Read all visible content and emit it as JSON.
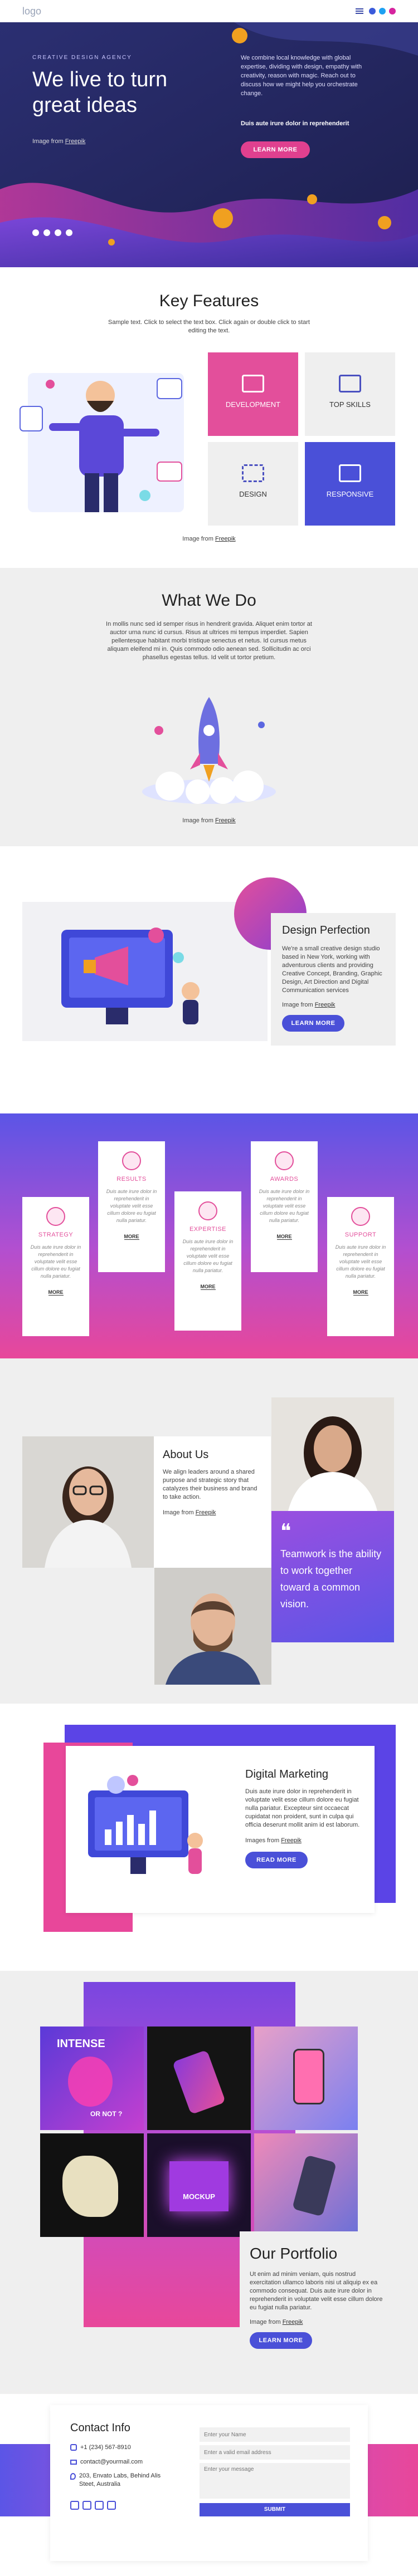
{
  "header": {
    "logo": "logo",
    "colors": {
      "menu": "#3b4aa8",
      "facebook": "#3b5bdb",
      "twitter": "#1da1f2",
      "instagram": "#d6249f"
    }
  },
  "hero": {
    "eyebrow": "CREATIVE DESIGN AGENCY",
    "title_line1": "We live to turn",
    "title_line2": "great ideas",
    "body": "We combine local knowledge with global expertise, dividing with design, empathy with creativity, reason with magic. Reach out to discuss how we might help you orchestrate change.",
    "subhead": "Duis aute irure dolor in reprehenderit",
    "button": "LEARN MORE",
    "credit_prefix": "Image from",
    "credit_link": "Freepik"
  },
  "features": {
    "title": "Key Features",
    "subtitle": "Sample text. Click to select the text box. Click again or double click to start editing the text.",
    "tiles": [
      {
        "label": "DEVELOPMENT",
        "icon": "monitor-icon"
      },
      {
        "label": "TOP SKILLS",
        "icon": "briefcase-icon"
      },
      {
        "label": "DESIGN",
        "icon": "grid-icon"
      },
      {
        "label": "RESPONSIVE",
        "icon": "devices-icon"
      }
    ],
    "credit_prefix": "Image from",
    "credit_link": "Freepik"
  },
  "whatwedo": {
    "title": "What We Do",
    "body": "In mollis nunc sed id semper risus in hendrerit gravida. Aliquet enim tortor at auctor urna nunc id cursus. Risus at ultrices mi tempus imperdiet. Sapien pellentesque habitant morbi tristique senectus et netus. Id cursus metus aliquam eleifend mi in. Quis commodo odio aenean sed. Sollicitudin ac orci phasellus egestas tellus. Id velit ut tortor pretium.",
    "credit_prefix": "Image from",
    "credit_link": "Freepik"
  },
  "perfection": {
    "title": "Design Perfection",
    "body": "We're a small creative design studio based in New York, working with adventurous clients and providing Creative Concept, Branding, Graphic Design, Art Direction and Digital Communication services",
    "credit_prefix": "Image from",
    "credit_link": "Freepik",
    "button": "LEARN MORE"
  },
  "cards": [
    {
      "title": "STRATEGY",
      "desc": "Duis aute irure dolor in reprehenderit in voluptate velit esse cillum dolore eu fugiat nulla pariatur.",
      "more": "MORE"
    },
    {
      "title": "RESULTS",
      "desc": "Duis aute irure dolor in reprehenderit in voluptate velit esse cillum dolore eu fugiat nulla pariatur.",
      "more": "MORE"
    },
    {
      "title": "EXPERTISE",
      "desc": "Duis aute irure dolor in reprehenderit in voluptate velit esse cillum dolore eu fugiat nulla pariatur.",
      "more": "MORE"
    },
    {
      "title": "AWARDS",
      "desc": "Duis aute irure dolor in reprehenderit in voluptate velit esse cillum dolore eu fugiat nulla pariatur.",
      "more": "MORE"
    },
    {
      "title": "SUPPORT",
      "desc": "Duis aute irure dolor in reprehenderit in voluptate velit esse cillum dolore eu fugiat nulla pariatur.",
      "more": "MORE"
    }
  ],
  "about": {
    "title": "About Us",
    "body": "We align leaders around a shared purpose and strategic story that catalyzes their business and brand to take action.",
    "credit_prefix": "Image from",
    "credit_link": "Freepik",
    "quote": "Teamwork is the ability to work together toward a common vision."
  },
  "digital": {
    "title": "Digital Marketing",
    "body": "Duis aute irure dolor in reprehenderit in voluptate velit esse cillum dolore eu fugiat nulla pariatur. Excepteur sint occaecat cupidatat non proident, sunt in culpa qui officia deserunt mollit anim id est laborum.",
    "credit_prefix": "Images from",
    "credit_link": "Freepik",
    "button": "READ MORE"
  },
  "portfolio": {
    "title": "Our Portfolio",
    "body": "Ut enim ad minim veniam, quis nostrud exercitation ullamco laboris nisi ut aliquip ex ea commodo consequat. Duis aute irure dolor in reprehenderit in voluptate velit esse cillum dolore eu fugiat nulla pariatur.",
    "credit_prefix": "Image from",
    "credit_link": "Freepik",
    "button": "LEARN MORE",
    "tile1_line1": "INTENSE",
    "tile1_line2": "OR NOT ?",
    "tile6_label": "MOCKUP"
  },
  "contact": {
    "title": "Contact Info",
    "phone": "+1 (234) 567-8910",
    "email": "contact@yourmail.com",
    "address": "203, Envato Labs, Behind Alis Steet, Australia",
    "name_placeholder": "Enter your Name",
    "email_placeholder": "Enter a valid email address",
    "message_placeholder": "Enter your message",
    "submit": "SUBMIT"
  }
}
